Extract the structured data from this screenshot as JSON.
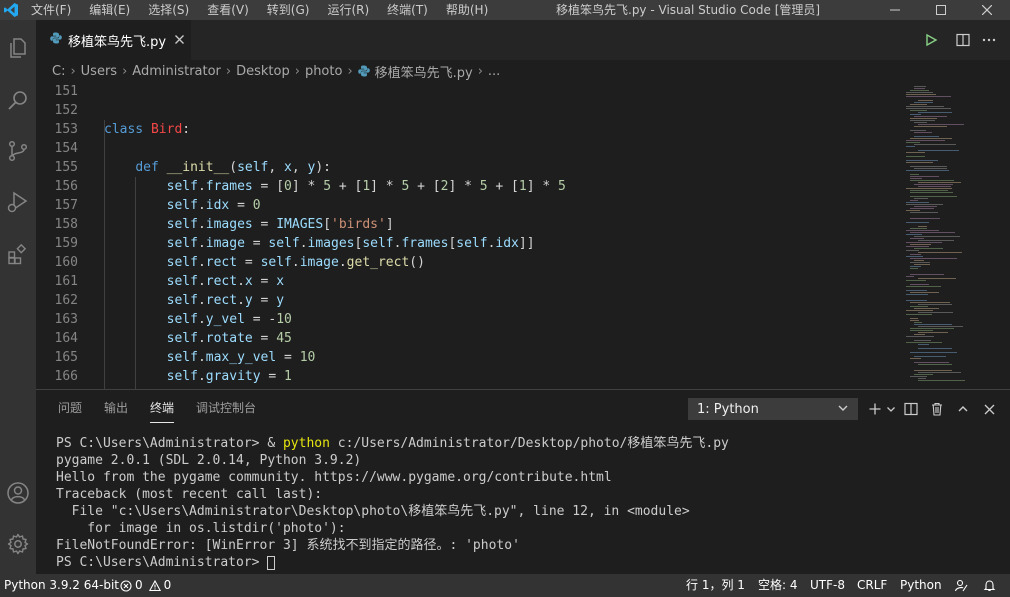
{
  "window": {
    "menu": [
      "文件(F)",
      "编辑(E)",
      "选择(S)",
      "查看(V)",
      "转到(G)",
      "运行(R)",
      "终端(T)",
      "帮助(H)"
    ],
    "title": "移植笨鸟先飞.py - Visual Studio Code [管理员]"
  },
  "tab": {
    "label": "移植笨鸟先飞.py"
  },
  "breadcrumb": [
    "C:",
    "Users",
    "Administrator",
    "Desktop",
    "photo",
    "移植笨鸟先飞.py",
    "..."
  ],
  "editor": {
    "line_numbers": [
      "151",
      "152",
      "153",
      "154",
      "155",
      "156",
      "157",
      "158",
      "159",
      "160",
      "161",
      "162",
      "163",
      "164",
      "165",
      "166"
    ],
    "tokens": [
      [],
      [],
      [
        [
          "kw",
          "class "
        ],
        [
          "cls",
          "Bird"
        ],
        [
          "p",
          ":"
        ]
      ],
      [],
      [
        [
          "p",
          "    "
        ],
        [
          "kw",
          "def "
        ],
        [
          "fn",
          "__init__"
        ],
        [
          "p",
          "("
        ],
        [
          "var",
          "self"
        ],
        [
          "p",
          ", "
        ],
        [
          "var",
          "x"
        ],
        [
          "p",
          ", "
        ],
        [
          "var",
          "y"
        ],
        [
          "p",
          "):"
        ]
      ],
      [
        [
          "p",
          "        "
        ],
        [
          "var",
          "self"
        ],
        [
          "p",
          "."
        ],
        [
          "var",
          "frames"
        ],
        [
          "p",
          " = ["
        ],
        [
          "num",
          "0"
        ],
        [
          "p",
          "] * "
        ],
        [
          "num",
          "5"
        ],
        [
          "p",
          " + ["
        ],
        [
          "num",
          "1"
        ],
        [
          "p",
          "] * "
        ],
        [
          "num",
          "5"
        ],
        [
          "p",
          " + ["
        ],
        [
          "num",
          "2"
        ],
        [
          "p",
          "] * "
        ],
        [
          "num",
          "5"
        ],
        [
          "p",
          " + ["
        ],
        [
          "num",
          "1"
        ],
        [
          "p",
          "] * "
        ],
        [
          "num",
          "5"
        ]
      ],
      [
        [
          "p",
          "        "
        ],
        [
          "var",
          "self"
        ],
        [
          "p",
          "."
        ],
        [
          "var",
          "idx"
        ],
        [
          "p",
          " = "
        ],
        [
          "num",
          "0"
        ]
      ],
      [
        [
          "p",
          "        "
        ],
        [
          "var",
          "self"
        ],
        [
          "p",
          "."
        ],
        [
          "var",
          "images"
        ],
        [
          "p",
          " = "
        ],
        [
          "var",
          "IMAGES"
        ],
        [
          "p",
          "["
        ],
        [
          "str",
          "'birds'"
        ],
        [
          "p",
          "]"
        ]
      ],
      [
        [
          "p",
          "        "
        ],
        [
          "var",
          "self"
        ],
        [
          "p",
          "."
        ],
        [
          "var",
          "image"
        ],
        [
          "p",
          " = "
        ],
        [
          "var",
          "self"
        ],
        [
          "p",
          "."
        ],
        [
          "var",
          "images"
        ],
        [
          "p",
          "["
        ],
        [
          "var",
          "self"
        ],
        [
          "p",
          "."
        ],
        [
          "var",
          "frames"
        ],
        [
          "p",
          "["
        ],
        [
          "var",
          "self"
        ],
        [
          "p",
          "."
        ],
        [
          "var",
          "idx"
        ],
        [
          "p",
          "]]"
        ]
      ],
      [
        [
          "p",
          "        "
        ],
        [
          "var",
          "self"
        ],
        [
          "p",
          "."
        ],
        [
          "var",
          "rect"
        ],
        [
          "p",
          " = "
        ],
        [
          "var",
          "self"
        ],
        [
          "p",
          "."
        ],
        [
          "var",
          "image"
        ],
        [
          "p",
          "."
        ],
        [
          "fn",
          "get_rect"
        ],
        [
          "p",
          "()"
        ]
      ],
      [
        [
          "p",
          "        "
        ],
        [
          "var",
          "self"
        ],
        [
          "p",
          "."
        ],
        [
          "var",
          "rect"
        ],
        [
          "p",
          "."
        ],
        [
          "var",
          "x"
        ],
        [
          "p",
          " = "
        ],
        [
          "var",
          "x"
        ]
      ],
      [
        [
          "p",
          "        "
        ],
        [
          "var",
          "self"
        ],
        [
          "p",
          "."
        ],
        [
          "var",
          "rect"
        ],
        [
          "p",
          "."
        ],
        [
          "var",
          "y"
        ],
        [
          "p",
          " = "
        ],
        [
          "var",
          "y"
        ]
      ],
      [
        [
          "p",
          "        "
        ],
        [
          "var",
          "self"
        ],
        [
          "p",
          "."
        ],
        [
          "var",
          "y_vel"
        ],
        [
          "p",
          " = -"
        ],
        [
          "num",
          "10"
        ]
      ],
      [
        [
          "p",
          "        "
        ],
        [
          "var",
          "self"
        ],
        [
          "p",
          "."
        ],
        [
          "var",
          "rotate"
        ],
        [
          "p",
          " = "
        ],
        [
          "num",
          "45"
        ]
      ],
      [
        [
          "p",
          "        "
        ],
        [
          "var",
          "self"
        ],
        [
          "p",
          "."
        ],
        [
          "var",
          "max_y_vel"
        ],
        [
          "p",
          " = "
        ],
        [
          "num",
          "10"
        ]
      ],
      [
        [
          "p",
          "        "
        ],
        [
          "var",
          "self"
        ],
        [
          "p",
          "."
        ],
        [
          "var",
          "gravity"
        ],
        [
          "p",
          " = "
        ],
        [
          "num",
          "1"
        ]
      ]
    ]
  },
  "panel": {
    "tabs": [
      "问题",
      "输出",
      "终端",
      "调试控制台"
    ],
    "active_tab": "终端",
    "terminal_select": "1: Python",
    "terminal": {
      "line1_prompt": "PS C:\\Users\\Administrator> & ",
      "line1_cmd": "python",
      "line1_rest": " c:/Users/Administrator/Desktop/photo/移植笨鸟先飞.py",
      "lines": [
        "pygame 2.0.1 (SDL 2.0.14, Python 3.9.2)",
        "Hello from the pygame community. https://www.pygame.org/contribute.html",
        "Traceback (most recent call last):",
        "  File \"c:\\Users\\Administrator\\Desktop\\photo\\移植笨鸟先飞.py\", line 12, in <module>",
        "    for image in os.listdir('photo'):",
        "FileNotFoundError: [WinError 3] 系统找不到指定的路径。: 'photo'"
      ],
      "last_prompt": "PS C:\\Users\\Administrator> "
    }
  },
  "status": {
    "interpreter": "Python 3.9.2 64-bit",
    "errors": "0",
    "warnings": "0",
    "position": "行 1，列 1",
    "spaces": "空格: 4",
    "encoding": "UTF-8",
    "eol": "CRLF",
    "language": "Python"
  }
}
